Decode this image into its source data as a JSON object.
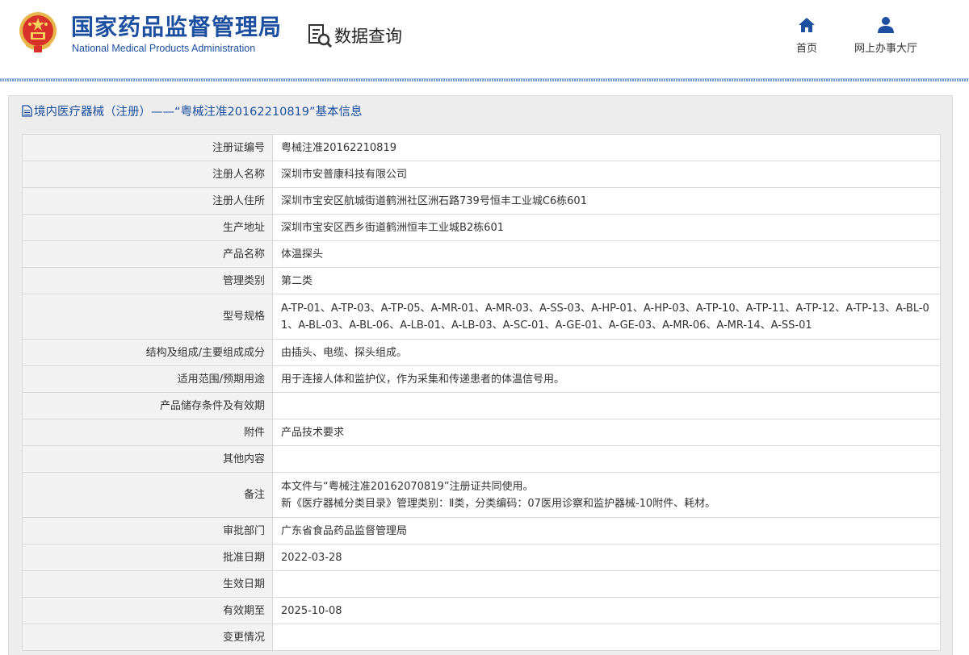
{
  "header": {
    "brand_cn": "国家药品监督管理局",
    "brand_en": "National Medical Products Administration",
    "query_label": "数据查询",
    "nav": {
      "home": "首页",
      "online_hall": "网上办事大厅"
    }
  },
  "panel": {
    "title": "境内医疗器械（注册）——“粤械注准20162210819”基本信息"
  },
  "rows": [
    {
      "label": "注册证编号",
      "value": "粤械注准20162210819"
    },
    {
      "label": "注册人名称",
      "value": "深圳市安普康科技有限公司"
    },
    {
      "label": "注册人住所",
      "value": "深圳市宝安区航城街道鹤洲社区洲石路739号恒丰工业城C6栋601"
    },
    {
      "label": "生产地址",
      "value": "深圳市宝安区西乡街道鹤洲恒丰工业城B2栋601"
    },
    {
      "label": "产品名称",
      "value": "体温探头"
    },
    {
      "label": "管理类别",
      "value": "第二类"
    },
    {
      "label": "型号规格",
      "value": "A-TP-01、A-TP-03、A-TP-05、A-MR-01、A-MR-03、A-SS-03、A-HP-01、A-HP-03、A-TP-10、A-TP-11、A-TP-12、A-TP-13、A-BL-01、A-BL-03、A-BL-06、A-LB-01、A-LB-03、A-SC-01、A-GE-01、A-GE-03、A-MR-06、A-MR-14、A-SS-01"
    },
    {
      "label": "结构及组成/主要组成成分",
      "value": "由插头、电缆、探头组成。"
    },
    {
      "label": "适用范围/预期用途",
      "value": "用于连接人体和监护仪，作为采集和传递患者的体温信号用。"
    },
    {
      "label": "产品储存条件及有效期",
      "value": ""
    },
    {
      "label": "附件",
      "value": "产品技术要求"
    },
    {
      "label": "其他内容",
      "value": ""
    },
    {
      "label": "备注",
      "value_line1": "本文件与“粤械注准20162070819”注册证共同使用。",
      "value_line2": "新《医疗器械分类目录》管理类别：Ⅱ类，分类编码：07医用诊察和监护器械-10附件、耗材。"
    },
    {
      "label": "审批部门",
      "value": "广东省食品药品监督管理局"
    },
    {
      "label": "批准日期",
      "value": "2022-03-28"
    },
    {
      "label": "生效日期",
      "value": ""
    },
    {
      "label": "有效期至",
      "value": "2025-10-08"
    },
    {
      "label": "变更情况",
      "value": ""
    }
  ]
}
